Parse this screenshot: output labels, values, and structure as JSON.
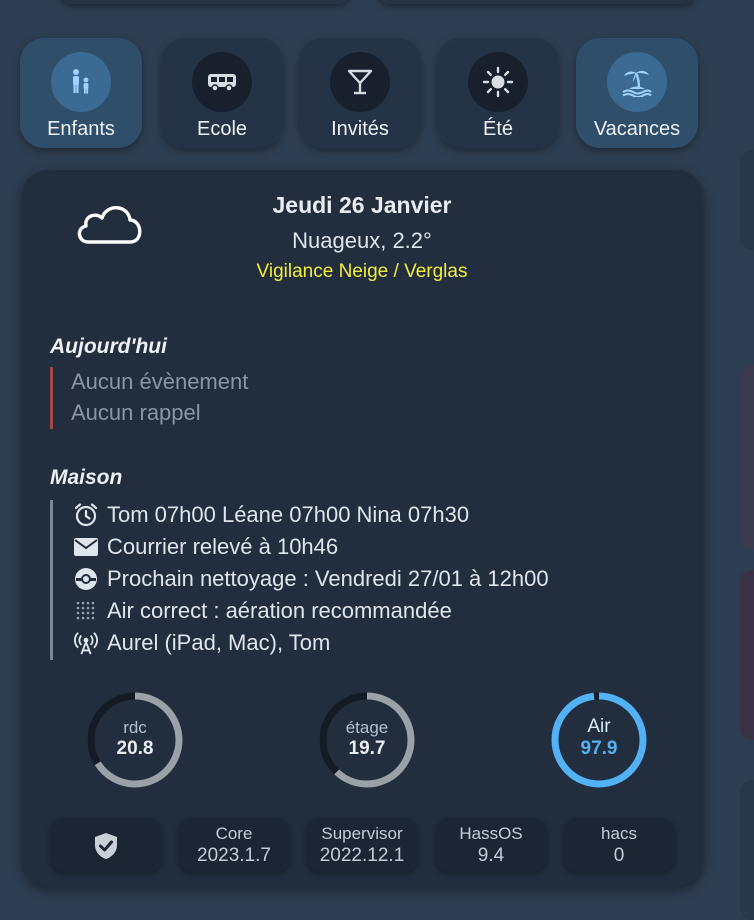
{
  "modes": [
    {
      "label": "Enfants",
      "icon": "family-icon",
      "active": true
    },
    {
      "label": "Ecole",
      "icon": "school-bus-icon",
      "active": false
    },
    {
      "label": "Invités",
      "icon": "cocktail-icon",
      "active": false
    },
    {
      "label": "Été",
      "icon": "sun-icon",
      "active": false
    },
    {
      "label": "Vacances",
      "icon": "island-icon",
      "active": true
    }
  ],
  "weather": {
    "icon": "cloud-icon",
    "date": "Jeudi 26 Janvier",
    "condition": "Nuageux, 2.2°",
    "alert": "Vigilance Neige / Verglas",
    "alert_color": "#f2ef3a"
  },
  "today": {
    "title": "Aujourd'hui",
    "events": "Aucun évènement",
    "reminders": "Aucun rappel",
    "accent_color": "#a44747"
  },
  "house": {
    "title": "Maison",
    "lines": [
      {
        "icon": "alarm-clock-icon",
        "text": "Tom 07h00 Léane 07h00 Nina 07h30"
      },
      {
        "icon": "mail-icon",
        "text": "Courrier relevé à 10h46"
      },
      {
        "icon": "robot-vacuum-icon",
        "text": "Prochain nettoyage : Vendredi 27/01 à 12h00"
      },
      {
        "icon": "air-dots-icon",
        "text": "Air correct : aération recommandée"
      },
      {
        "icon": "wifi-presence-icon",
        "text": "Aurel (iPad, Mac), Tom"
      }
    ]
  },
  "gauges": [
    {
      "name": "rdc",
      "value": "20.8",
      "fill": 0.66,
      "color": "#9aa1a8"
    },
    {
      "name": "étage",
      "value": "19.7",
      "fill": 0.62,
      "color": "#9aa1a8"
    },
    {
      "name": "Air",
      "value": "97.9",
      "fill": 0.98,
      "color": "#53b1f5"
    }
  ],
  "versions": [
    {
      "icon": "shield-check-icon",
      "label": "",
      "value": ""
    },
    {
      "label": "Core",
      "value": "2023.1.7"
    },
    {
      "label": "Supervisor",
      "value": "2022.12.1"
    },
    {
      "label": "HassOS",
      "value": "9.4"
    },
    {
      "label": "hacs",
      "value": "0"
    }
  ]
}
